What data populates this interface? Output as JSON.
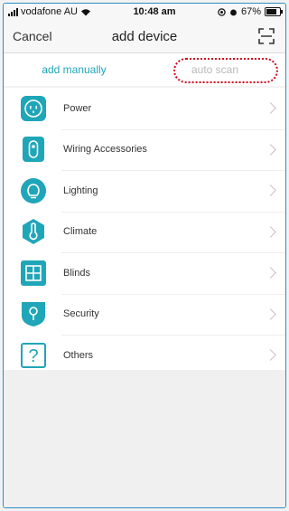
{
  "status_bar": {
    "carrier": "vodafone AU",
    "time": "10:48 am",
    "battery": "67%"
  },
  "nav": {
    "cancel_label": "Cancel",
    "title": "add device",
    "scan_icon": "scan-frame-icon"
  },
  "tabs": {
    "manual": "add manually",
    "auto": "auto scan"
  },
  "categories": [
    {
      "label": "Power",
      "icon": "power-socket-icon"
    },
    {
      "label": "Wiring Accessories",
      "icon": "switch-icon"
    },
    {
      "label": "Lighting",
      "icon": "bulb-icon"
    },
    {
      "label": "Climate",
      "icon": "thermometer-icon"
    },
    {
      "label": "Blinds",
      "icon": "window-icon"
    },
    {
      "label": "Security",
      "icon": "lock-icon"
    },
    {
      "label": "Others",
      "icon": "question-icon"
    }
  ],
  "colors": {
    "accent": "#1fa6b8",
    "highlight": "#d0021b"
  }
}
